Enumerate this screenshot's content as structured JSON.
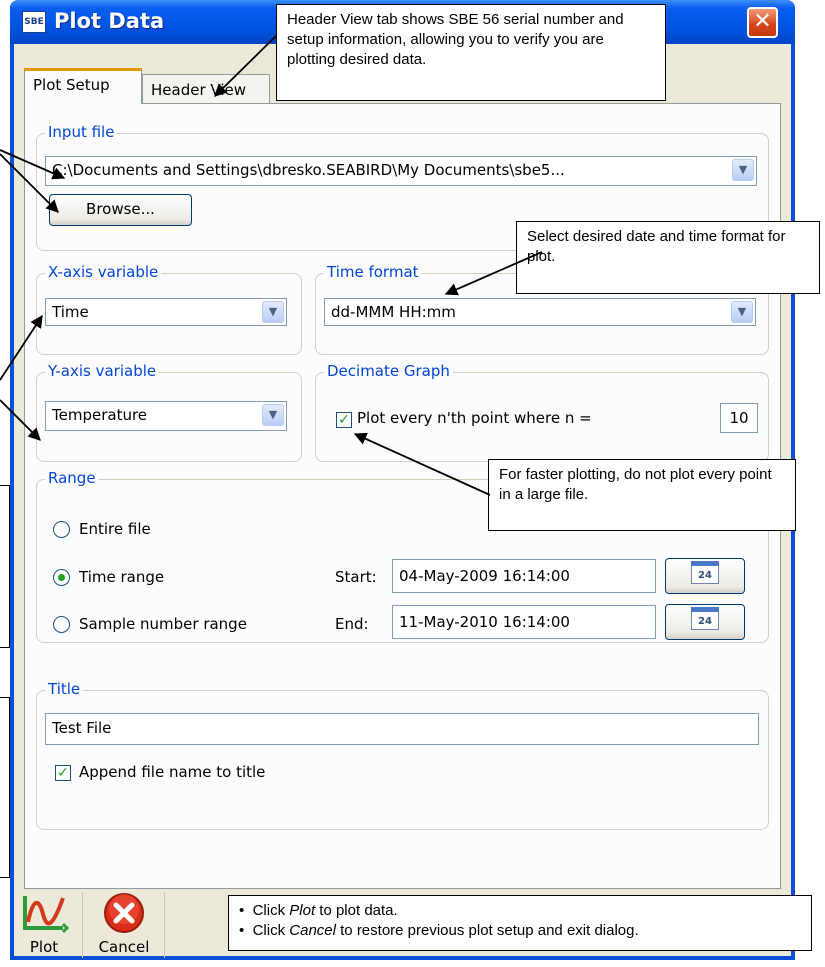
{
  "window": {
    "app_icon": "SBE",
    "title": "Plot Data",
    "close_icon": "close-icon"
  },
  "tabs": [
    {
      "label": "Plot Setup",
      "active": true
    },
    {
      "label": "Header View",
      "active": false
    }
  ],
  "input_file": {
    "group_label": "Input file",
    "path": "C:\\Documents and Settings\\dbresko.SEABIRD\\My Documents\\sbe5...",
    "browse_label": "Browse..."
  },
  "x_axis": {
    "group_label": "X-axis variable",
    "value": "Time"
  },
  "time_format": {
    "group_label": "Time format",
    "value": "dd-MMM HH:mm"
  },
  "y_axis": {
    "group_label": "Y-axis variable",
    "value": "Temperature"
  },
  "decimate": {
    "group_label": "Decimate Graph",
    "checkbox_label": "Plot every n'th point where n =",
    "checked": true,
    "n": "10"
  },
  "range": {
    "group_label": "Range",
    "options": [
      {
        "label": "Entire file",
        "selected": false
      },
      {
        "label": "Time range",
        "selected": true
      },
      {
        "label": "Sample number range",
        "selected": false
      }
    ],
    "start_label": "Start:",
    "start_value": "04-May-2009 16:14:00",
    "end_label": "End:",
    "end_value": "11-May-2010 16:14:00",
    "calendar_icon_text": "24"
  },
  "title_group": {
    "group_label": "Title",
    "value": "Test File",
    "append_label": "Append file name to title",
    "append_checked": true
  },
  "toolbar": {
    "plot_label": "Plot",
    "cancel_label": "Cancel"
  },
  "callouts": {
    "header_view": "Header View tab shows SBE 56 serial number and setup information, allowing you to verify you are plotting desired data.",
    "time_format": "Select desired date and time format for plot.",
    "decimate": "For faster plotting, do not plot every point in a large file.",
    "bullets": [
      {
        "prefix": "Click ",
        "em": "Plot",
        "suffix": " to plot data."
      },
      {
        "prefix": "Click ",
        "em": "Cancel",
        "suffix": " to restore previous plot setup and exit dialog."
      }
    ]
  },
  "colors": {
    "title_bar": "#0054e3",
    "group_label": "#0046d5",
    "check_mark": "#21a121",
    "cancel_red": "#d92d1a",
    "dialog_bg": "#ece9d8"
  }
}
